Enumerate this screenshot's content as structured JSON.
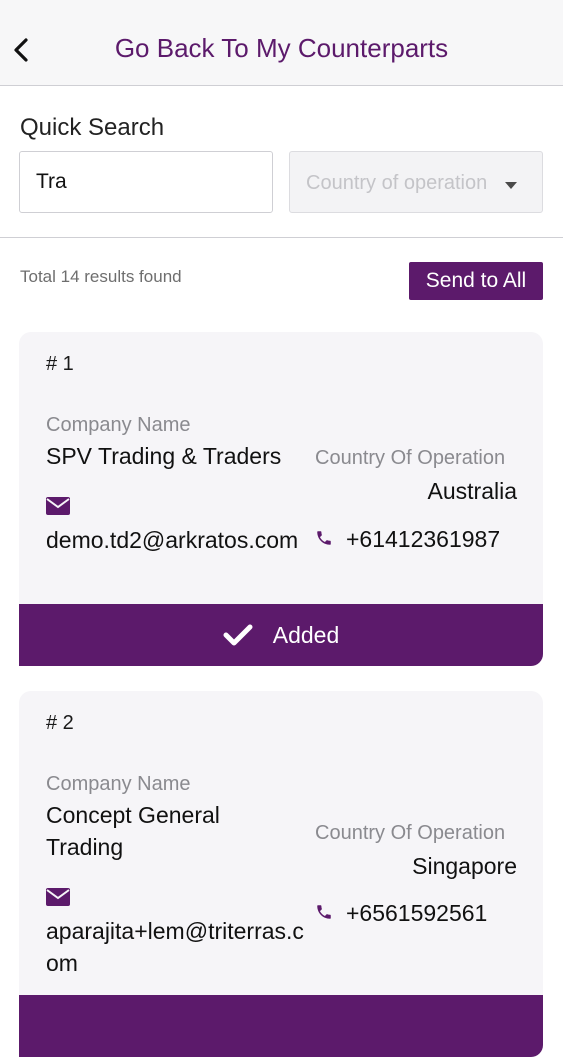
{
  "header": {
    "title": "Go Back To My Counterparts",
    "back_icon": "chevron-left-icon"
  },
  "search": {
    "label": "Quick Search",
    "query": "Tra",
    "country_placeholder": "Country of operation"
  },
  "results": {
    "count_text": "Total 14 results found",
    "send_all_label": "Send to All"
  },
  "labels": {
    "company_name": "Company Name",
    "country_of_operation": "Country Of Operation"
  },
  "cards": [
    {
      "index": "# 1",
      "company": "SPV Trading & Traders",
      "country": "Australia",
      "email": "demo.td2@arkratos.com",
      "phone": "+61412361987",
      "action_label": "Added"
    },
    {
      "index": "# 2",
      "company": "Concept General Trading",
      "country": "Singapore",
      "email": "aparajita+lem@triterras.com",
      "phone": "+6561592561"
    }
  ],
  "colors": {
    "brand": "#5c1a6b",
    "card_bg": "#f6f5f8",
    "muted_text": "#8a8a8f"
  }
}
